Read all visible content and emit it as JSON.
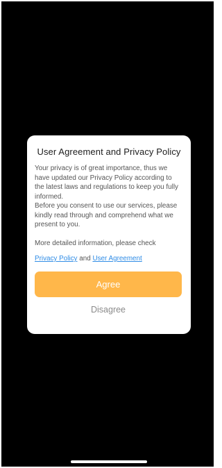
{
  "dialog": {
    "title": "User Agreement and Privacy Policy",
    "paragraph_1": "Your privacy is of great importance, thus we have updated our Privacy Policy according to the latest laws and regulations to keep you fully informed.",
    "paragraph_2": "Before you consent to use our services, please kindly read through and comprehend what we present to you.",
    "more_info": "More detailed information, please check",
    "privacy_policy_link": "Privacy Policy",
    "and_text": " and ",
    "user_agreement_link": "User Agreement",
    "agree_label": "Agree",
    "disagree_label": "Disagree"
  },
  "colors": {
    "background": "#000000",
    "dialog": "#ffffff",
    "accent": "#ffb74a",
    "link": "#2f8ce6",
    "secondary_text": "#8a8a8a"
  }
}
